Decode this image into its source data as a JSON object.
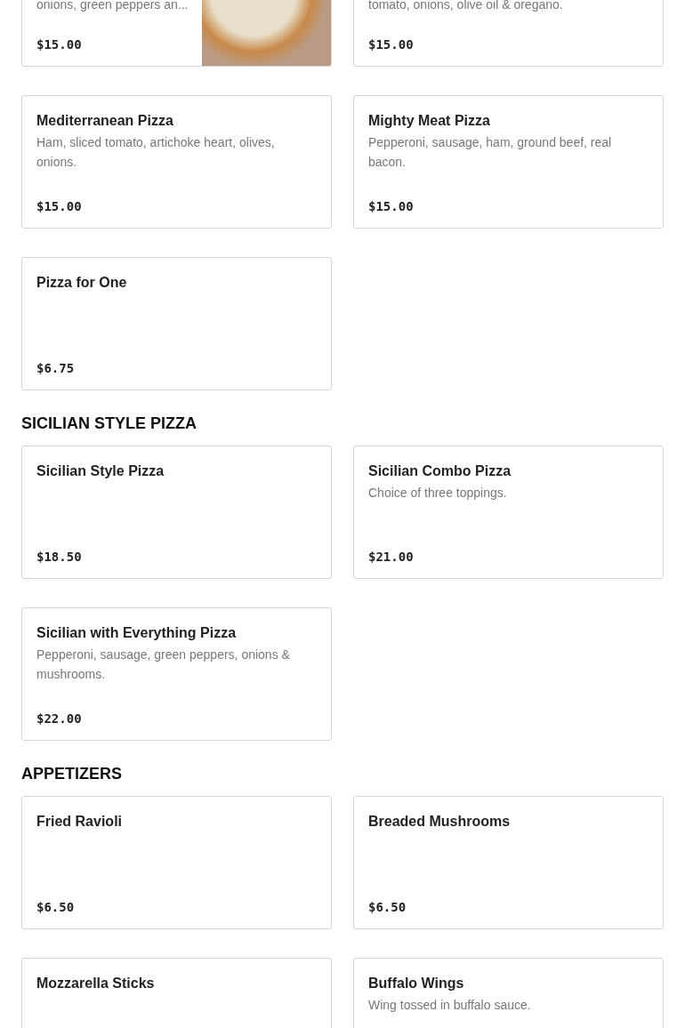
{
  "sections": [
    {
      "items": [
        {
          "description": "onions, green peppers an...",
          "price": "$15.00",
          "photo": true
        },
        {
          "description": "tomato, onions, olive oil & oregano.",
          "price": "$15.00",
          "photo": false
        },
        {
          "title": "Mediterranean Pizza",
          "description": "Ham, sliced tomato, artichoke heart, olives, onions.",
          "price": "$15.00",
          "photo": false
        },
        {
          "title": "Mighty Meat Pizza",
          "description": "Pepperoni, sausage, ham, ground beef, real bacon.",
          "price": "$15.00",
          "photo": false
        },
        {
          "title": "Pizza for One",
          "price": "$6.75",
          "photo": false
        }
      ]
    },
    {
      "heading": "SICILIAN STYLE PIZZA",
      "items": [
        {
          "title": "Sicilian Style Pizza",
          "price": "$18.50",
          "photo": false
        },
        {
          "title": "Sicilian Combo Pizza",
          "description": "Choice of three toppings.",
          "price": "$21.00",
          "photo": false
        },
        {
          "title": "Sicilian with Everything Pizza",
          "description": "Pepperoni, sausage, green peppers, onions & mushrooms.",
          "price": "$22.00",
          "photo": false
        }
      ]
    },
    {
      "heading": "APPETIZERS",
      "items": [
        {
          "title": "Fried Ravioli",
          "price": "$6.50",
          "photo": false
        },
        {
          "title": "Breaded Mushrooms",
          "price": "$6.50",
          "photo": false
        },
        {
          "title": "Mozzarella Sticks",
          "photo": false
        },
        {
          "title": "Buffalo Wings",
          "description": "Wing tossed in buffalo sauce.",
          "photo": false
        }
      ]
    }
  ]
}
